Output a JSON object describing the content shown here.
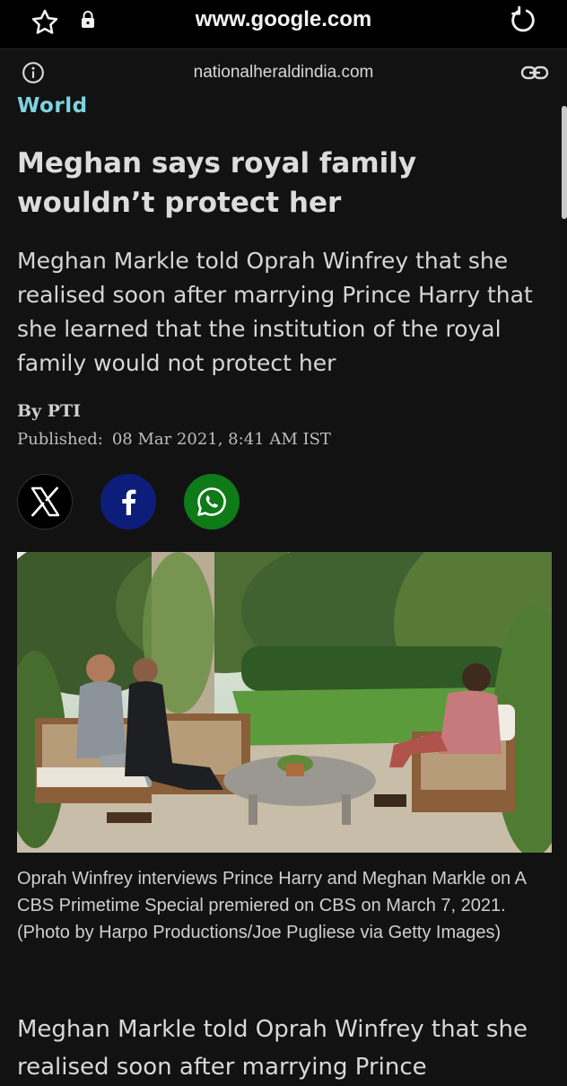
{
  "browser": {
    "url": "www.google.com",
    "icons": [
      "star-icon",
      "lock-icon",
      "reload-icon"
    ]
  },
  "site": {
    "domain": "nationalheraldindia.com",
    "icons": [
      "info-icon",
      "link-icon"
    ]
  },
  "article": {
    "category": "World",
    "headline": "Meghan says royal family wouldn’t protect her",
    "summary": "Meghan Markle told Oprah Winfrey that she realised soon after marrying Prince Harry that she learned that the institution of the royal family would not protect her",
    "byline": "By PTI",
    "published_label": "Published:",
    "published_date": "08 Mar 2021, 8:41 AM IST",
    "caption": "Oprah Winfrey interviews Prince Harry and Meghan Markle on A CBS Primetime Special premiered on CBS on March 7, 2021. (Photo by Harpo Productions/Joe Pugliese via Getty Images)",
    "body_start": "Meghan Markle told Oprah Winfrey that she realised soon after marrying Prince"
  },
  "share": {
    "buttons": [
      {
        "icon": "x-icon",
        "color": "#000000"
      },
      {
        "icon": "facebook-icon",
        "color": "#0c1e7a"
      },
      {
        "icon": "whatsapp-icon",
        "color": "#0e7a18"
      }
    ]
  },
  "colors": {
    "background": "#121212",
    "category": "#7fd3df",
    "text": "#dcdcdc"
  }
}
